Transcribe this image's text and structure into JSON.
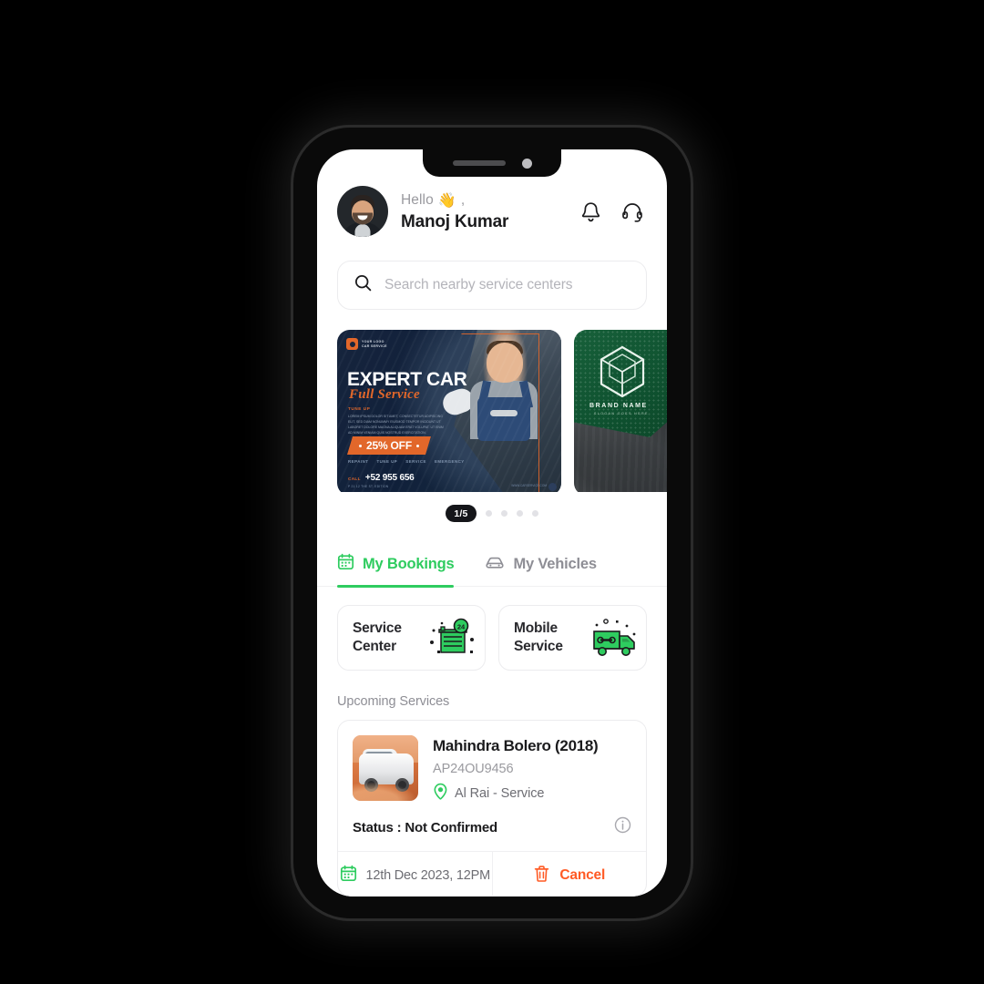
{
  "header": {
    "greeting": "Hello",
    "wave_emoji": "👋",
    "comma": ",",
    "user_name": "Manoj Kumar",
    "notification_icon": "bell-icon",
    "support_icon": "headset-icon"
  },
  "search": {
    "placeholder": "Search nearby service centers",
    "icon": "search-icon"
  },
  "carousel": {
    "counter": "1/5",
    "total_dots": 4,
    "banners": [
      {
        "logo_line1": "YOUR LOGO",
        "logo_line2": "CAR SERVICE",
        "title": "EXPERT CAR",
        "subtitle": "Full Service",
        "section_tag": "TUNE UP",
        "body": "LOREM IPSUM DOLOR SIT AMET, CONSECTETUR ADIPISCING ELIT, SED DIAM NONUMMY EIUSMOD TEMPOR INCIDUNT UT LABORET DOLORE MAGNA ALIQUAM ERAT VOLUPAT. UT ENIM AD MINIM VENIAM QUIS NOSTRUD EXERCITATION.",
        "discount": "25% OFF",
        "services": [
          "REPAINT",
          "TUNE UP",
          "SERVICE",
          "EMERGENCY"
        ],
        "call_label": "CALL",
        "phone": "+52 955 656",
        "address": "P 21 12 THE ST. EDITION",
        "website": "WWW.CARSERVICE.COM"
      },
      {
        "brand_name": "BRAND NAME",
        "brand_slogan": "SLOGAN GOES HERE"
      }
    ]
  },
  "tabs": [
    {
      "label": "My Bookings",
      "icon": "calendar-icon",
      "active": true
    },
    {
      "label": "My Vehicles",
      "icon": "car-icon",
      "active": false
    }
  ],
  "service_types": [
    {
      "label_line1": "Service",
      "label_line2": "Center",
      "icon": "garage-24h-icon",
      "badge": "24"
    },
    {
      "label_line1": "Mobile",
      "label_line2": "Service",
      "icon": "service-truck-icon"
    }
  ],
  "upcoming": {
    "section_title": "Upcoming Services",
    "booking": {
      "vehicle_name": "Mahindra Bolero (2018)",
      "plate_number": "AP24OU9456",
      "location": "Al Rai - Service",
      "location_icon": "location-pin-icon",
      "status_label": "Status : Not Confirmed",
      "info_icon": "info-icon",
      "date": "12th Dec 2023, 12PM",
      "date_icon": "calendar-icon",
      "cancel_label": "Cancel",
      "cancel_icon": "trash-icon",
      "thumbnail": "suv-photo"
    }
  },
  "colors": {
    "accent_green": "#2ECC5F",
    "cancel_orange": "#FF5A24",
    "banner_orange": "#E2672A",
    "text_dark": "#1B1B1D",
    "text_muted": "#9A9A9F"
  }
}
